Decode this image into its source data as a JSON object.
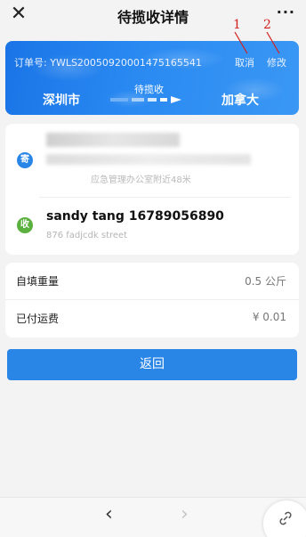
{
  "header": {
    "close_icon": "close-icon",
    "title": "待揽收详情",
    "more_icon": "more-icon",
    "more_text": "···"
  },
  "order": {
    "number_label": "订单号:",
    "number": "YWLS20050920001475165541",
    "cancel_label": "取消",
    "modify_label": "修改",
    "from_city": "深圳市",
    "to_city": "加拿大",
    "status": "待揽收"
  },
  "annotations": {
    "a1": "1",
    "a2": "2",
    "color": "#d2211c"
  },
  "sender": {
    "tag": "寄",
    "address_hint": "应急管理办公室附近48米"
  },
  "receiver": {
    "tag": "收",
    "name_phone": "sandy tang   16789056890",
    "address": "876 fadjcdk street"
  },
  "fees": {
    "weight_label": "自填重量",
    "weight_value": "0.5 公斤",
    "paid_label": "已付运费",
    "paid_value": "¥ 0.01"
  },
  "actions": {
    "return_label": "返回"
  },
  "nav": {
    "back_glyph": "‹",
    "forward_glyph": "›",
    "link_icon": "link-icon"
  },
  "colors": {
    "brand_blue": "#2a86e6",
    "receiver_green": "#5bb13f"
  }
}
